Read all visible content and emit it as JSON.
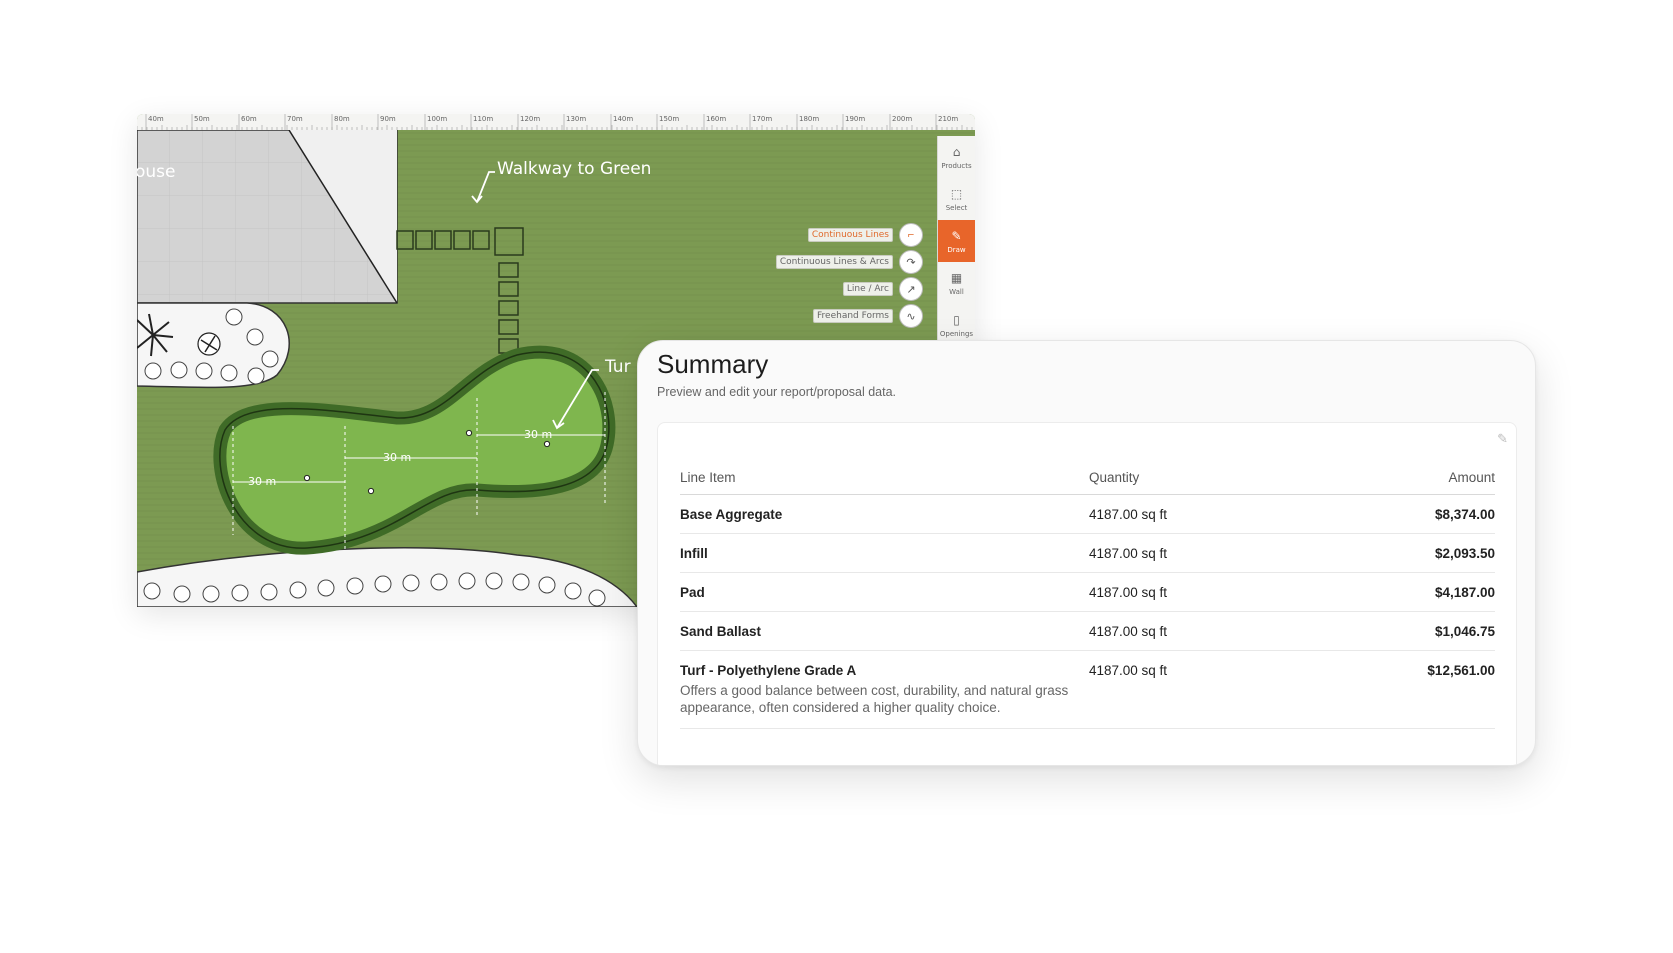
{
  "canvas": {
    "ruler_labels": [
      "40m",
      "50m",
      "60m",
      "70m",
      "80m",
      "90m",
      "100m",
      "110m",
      "120m",
      "130m",
      "140m",
      "150m",
      "160m",
      "170m",
      "180m",
      "190m",
      "200m",
      "210m"
    ],
    "house_label": "ouse",
    "walkway_label": "Walkway to Green",
    "turf_label": "Tur",
    "dimensions": [
      "30 m",
      "30 m",
      "30 m"
    ],
    "colors": {
      "lawn": "#7c9a52",
      "green_fill": "#7fb64e",
      "green_border": "#3f6b27",
      "accent": "#e8652a"
    }
  },
  "draw_menu": {
    "options": [
      {
        "label": "Continuous Lines",
        "icon": "continuous-lines-icon",
        "active": true
      },
      {
        "label": "Continuous Lines & Arcs",
        "icon": "lines-arcs-icon",
        "active": false
      },
      {
        "label": "Line / Arc",
        "icon": "line-arc-icon",
        "active": false
      },
      {
        "label": "Freehand Forms",
        "icon": "freehand-icon",
        "active": false
      }
    ]
  },
  "toolbar": {
    "buttons": [
      {
        "label": "Products",
        "icon": "tag-icon"
      },
      {
        "label": "Select",
        "icon": "select-icon"
      },
      {
        "label": "Draw",
        "icon": "draw-icon",
        "active": true
      },
      {
        "label": "Wall",
        "icon": "wall-icon"
      },
      {
        "label": "Openings",
        "icon": "door-icon"
      }
    ]
  },
  "summary": {
    "title": "Summary",
    "subtitle": "Preview and edit your report/proposal data.",
    "columns": {
      "item": "Line Item",
      "quantity": "Quantity",
      "amount": "Amount"
    },
    "rows": [
      {
        "item": "Base Aggregate",
        "quantity": "4187.00 sq ft",
        "amount": "$8,374.00"
      },
      {
        "item": "Infill",
        "quantity": "4187.00 sq ft",
        "amount": "$2,093.50"
      },
      {
        "item": "Pad",
        "quantity": "4187.00 sq ft",
        "amount": "$4,187.00"
      },
      {
        "item": "Sand Ballast",
        "quantity": "4187.00 sq ft",
        "amount": "$1,046.75"
      },
      {
        "item": "Turf - Polyethylene Grade A",
        "quantity": "4187.00 sq ft",
        "amount": "$12,561.00",
        "description": "Offers a good balance between cost, durability, and natural grass appearance, often considered a higher quality choice."
      }
    ]
  }
}
